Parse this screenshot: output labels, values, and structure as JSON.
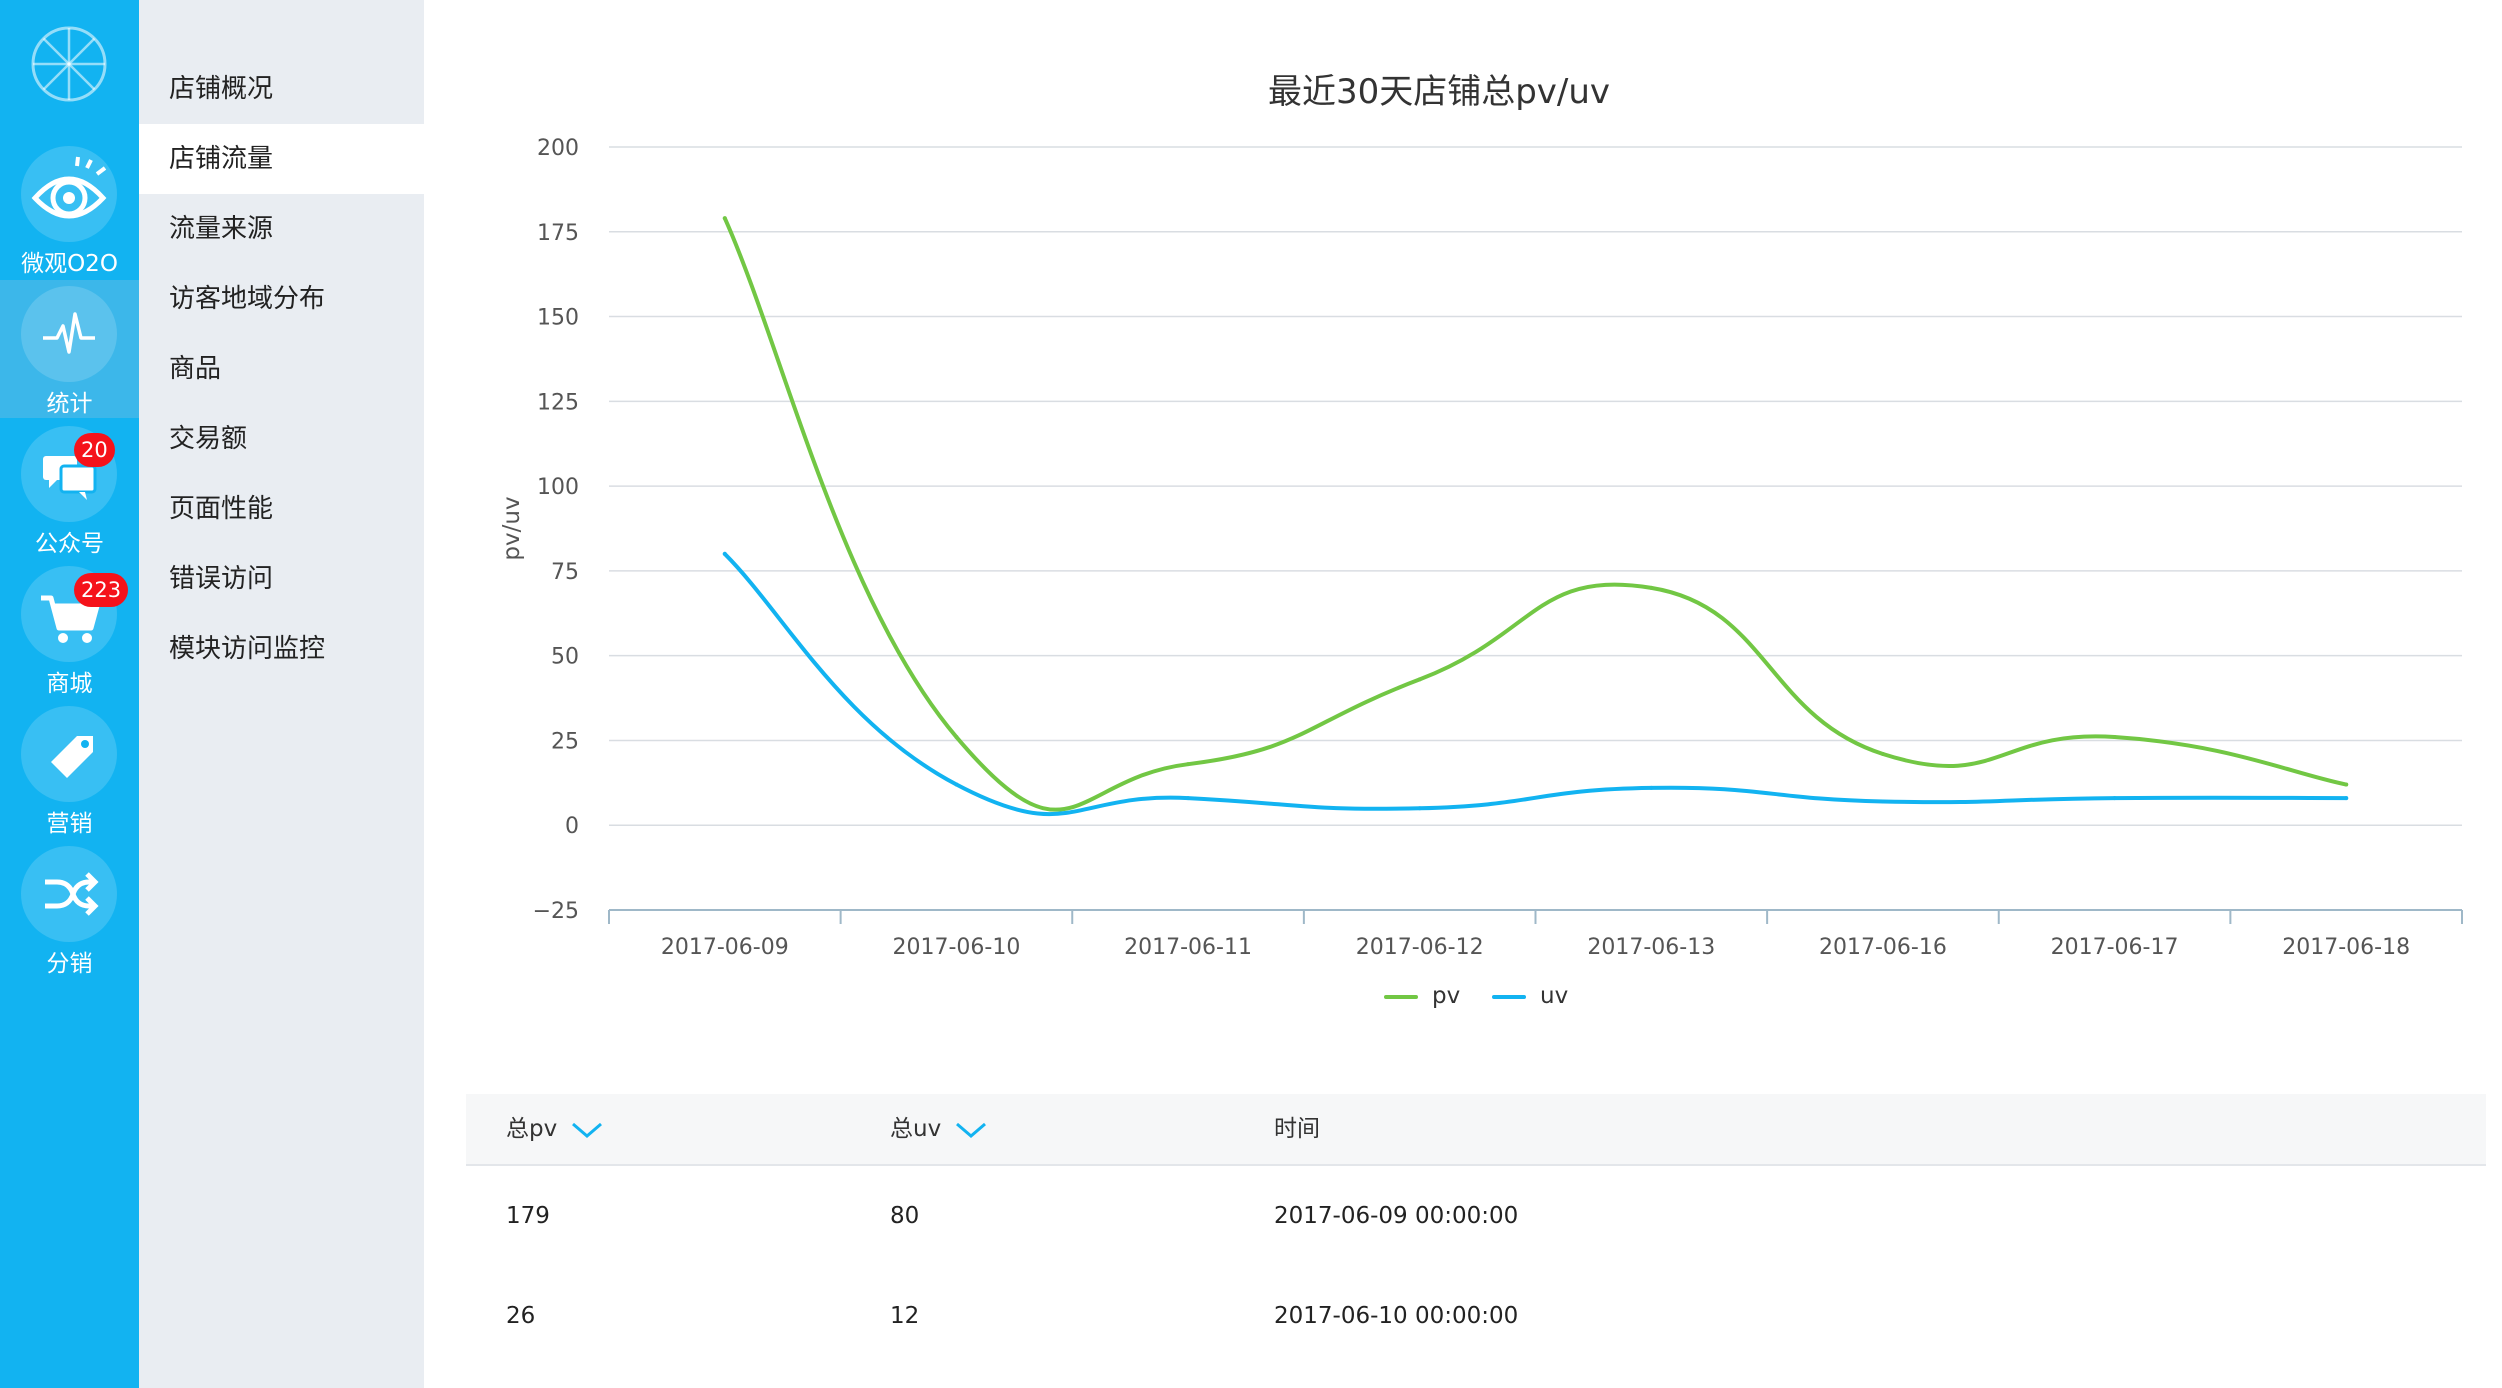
{
  "rail": {
    "items": [
      {
        "label": "微观O2O",
        "icon": "eye-icon"
      },
      {
        "label": "统计",
        "icon": "pulse-icon",
        "active": true
      },
      {
        "label": "公众号",
        "icon": "chat-icon",
        "badge": "20"
      },
      {
        "label": "商城",
        "icon": "cart-icon",
        "badge": "223"
      },
      {
        "label": "营销",
        "icon": "tag-icon"
      },
      {
        "label": "分销",
        "icon": "shuffle-icon"
      }
    ]
  },
  "submenu": {
    "items": [
      {
        "label": "店铺概况"
      },
      {
        "label": "店铺流量",
        "active": true
      },
      {
        "label": "流量来源"
      },
      {
        "label": "访客地域分布"
      },
      {
        "label": "商品"
      },
      {
        "label": "交易额"
      },
      {
        "label": "页面性能"
      },
      {
        "label": "错误访问"
      },
      {
        "label": "模块访问监控"
      }
    ]
  },
  "colors": {
    "rail": "#12b3f1",
    "pv": "#72c744",
    "uv": "#12b3f1"
  },
  "chart_data": {
    "type": "line",
    "title": "最近30天店铺总pv/uv",
    "ylabel": "pv/uv",
    "xlabel": "",
    "ylim": [
      -25,
      200
    ],
    "yticks": [
      200,
      175,
      150,
      125,
      100,
      75,
      50,
      25,
      0,
      -25
    ],
    "categories": [
      "2017-06-09",
      "2017-06-10",
      "2017-06-11",
      "2017-06-12",
      "2017-06-13",
      "2017-06-16",
      "2017-06-17",
      "2017-06-18"
    ],
    "series": [
      {
        "name": "pv",
        "values": [
          179,
          26,
          18,
          43,
          70,
          21,
          26,
          12
        ]
      },
      {
        "name": "uv",
        "values": [
          80,
          12,
          8,
          5,
          11,
          7,
          8,
          8
        ]
      }
    ],
    "grid": true,
    "legend": "bottom-center"
  },
  "table": {
    "headers": [
      {
        "label": "总pv",
        "sortable": true
      },
      {
        "label": "总uv",
        "sortable": true
      },
      {
        "label": "时间",
        "sortable": false
      }
    ],
    "rows": [
      [
        "179",
        "80",
        "2017-06-09 00:00:00"
      ],
      [
        "26",
        "12",
        "2017-06-10 00:00:00"
      ]
    ]
  }
}
